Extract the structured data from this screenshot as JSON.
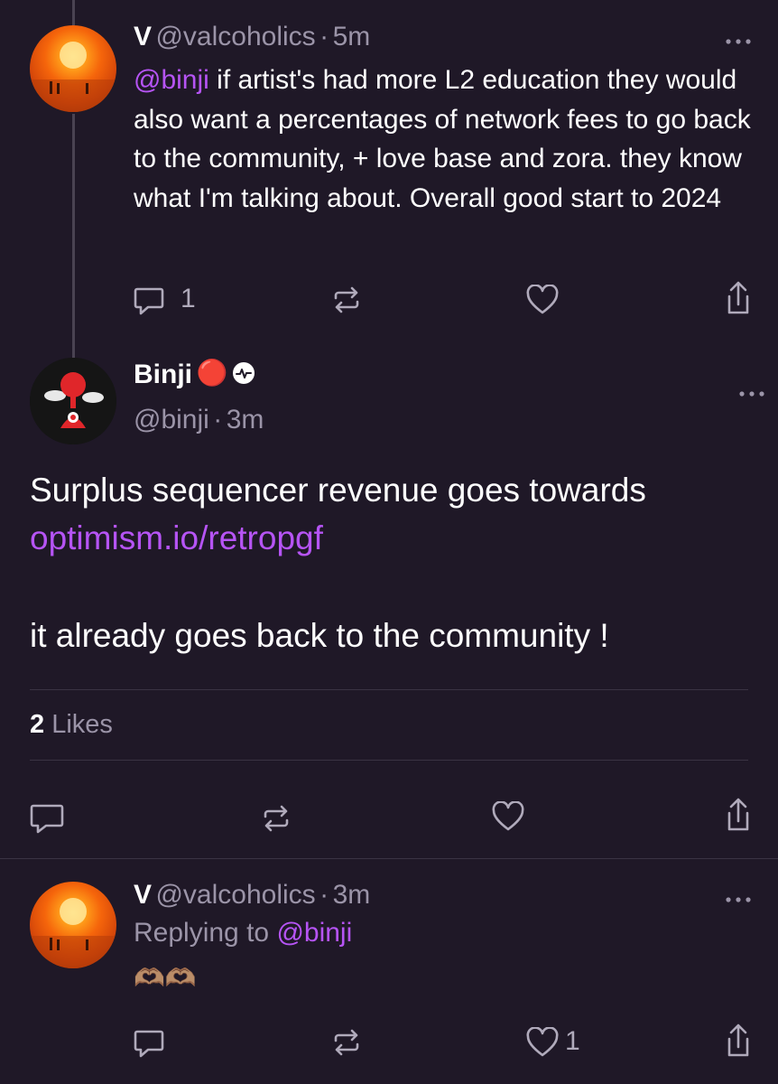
{
  "post1": {
    "name": "V",
    "handle": "@valcoholics",
    "separator": "·",
    "time": "5m",
    "mention": "@binji",
    "text": " if artist's had more L2 education they would also want a percentages of network fees to go back to the community, + love base and zora. they know what I'm talking about. Overall good start to 2024",
    "reply_count": "1",
    "icons": [
      "reply-icon",
      "repost-icon",
      "like-icon",
      "share-icon",
      "more-icon"
    ]
  },
  "main": {
    "name": "Binji",
    "status_emoji": "🔴",
    "handle": "@binji",
    "separator": "·",
    "time": "3m",
    "text_line1": "Surplus sequencer revenue goes towards",
    "link": "optimism.io/retropgf",
    "text_line2": "it already goes back to the community !",
    "likes_count": "2",
    "likes_label": "Likes",
    "icons": [
      "reply-icon",
      "repost-icon",
      "like-icon",
      "share-icon",
      "more-icon",
      "verified-badge-icon"
    ]
  },
  "post3": {
    "name": "V",
    "handle": "@valcoholics",
    "separator": "·",
    "time": "3m",
    "replying_prefix": "Replying to ",
    "replying_mention": "@binji",
    "emoji": "🫶🏽🫶🏽",
    "like_count": "1",
    "icons": [
      "reply-icon",
      "repost-icon",
      "like-icon",
      "share-icon",
      "more-icon"
    ]
  },
  "colors": {
    "background": "#1f1827",
    "accent": "#b654f5",
    "muted": "#9b94a8",
    "divider": "#3a3343"
  }
}
